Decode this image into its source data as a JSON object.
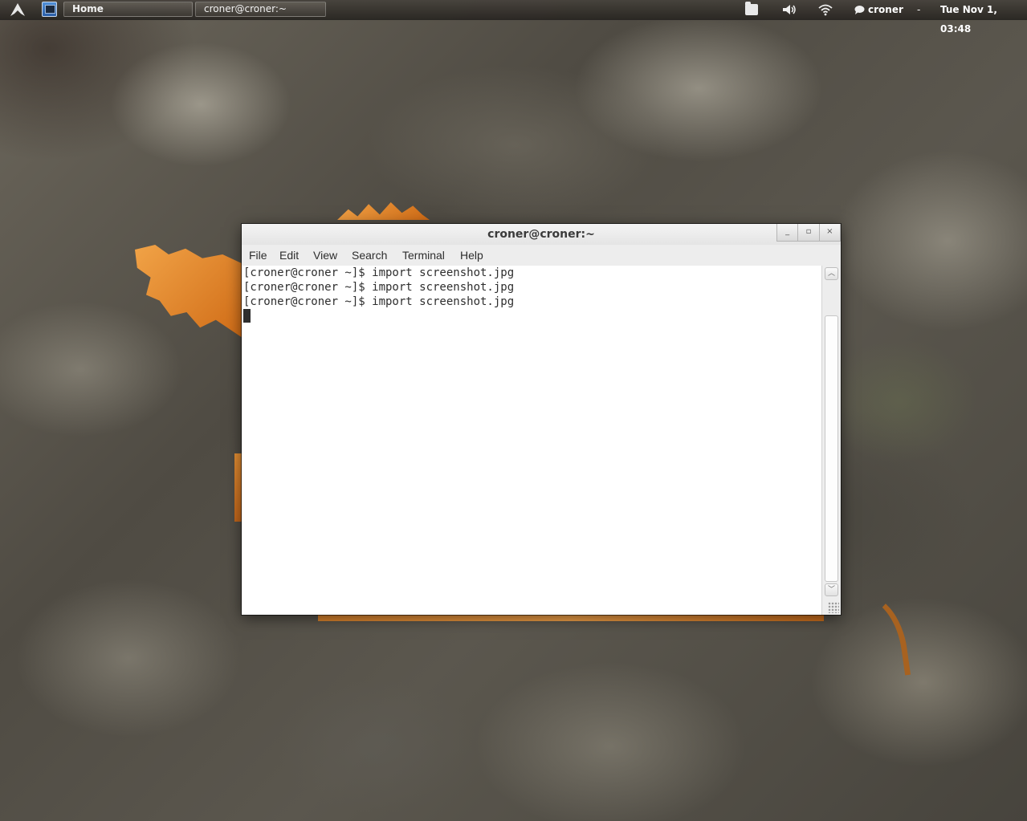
{
  "top_panel": {
    "app_menu_icon": "arch-logo-icon",
    "launcher_icon": "terminal-icon",
    "taskbar": [
      {
        "label": "Home",
        "active": true
      },
      {
        "label": "croner@croner:~",
        "active": false
      }
    ],
    "tray": {
      "folder_icon": "folder-icon",
      "volume_icon": "volume-icon",
      "wifi_icon": "wifi-icon",
      "user_icon": "chat-bubble-icon",
      "user_name": "croner",
      "separator": "-",
      "clock": "Tue Nov  1, 03:48"
    }
  },
  "window": {
    "title": "croner@croner:~",
    "controls": {
      "minimize": "_",
      "maximize": "▫",
      "close": "×"
    },
    "menu": [
      "File",
      "Edit",
      "View",
      "Search",
      "Terminal",
      "Help"
    ],
    "terminal_lines": [
      "[croner@croner ~]$ import screenshot.jpg",
      "[croner@croner ~]$ import screenshot.jpg",
      "[croner@croner ~]$ import screenshot.jpg"
    ],
    "scrollbar": {
      "up_arrow": "︿",
      "down_arrow": "﹀"
    }
  },
  "colors": {
    "panel_bg": "#3a3631",
    "window_bg": "#ededed",
    "terminal_bg": "#ffffff",
    "terminal_fg": "#2e2e2e",
    "leaf_accent": "#e08a2e"
  }
}
